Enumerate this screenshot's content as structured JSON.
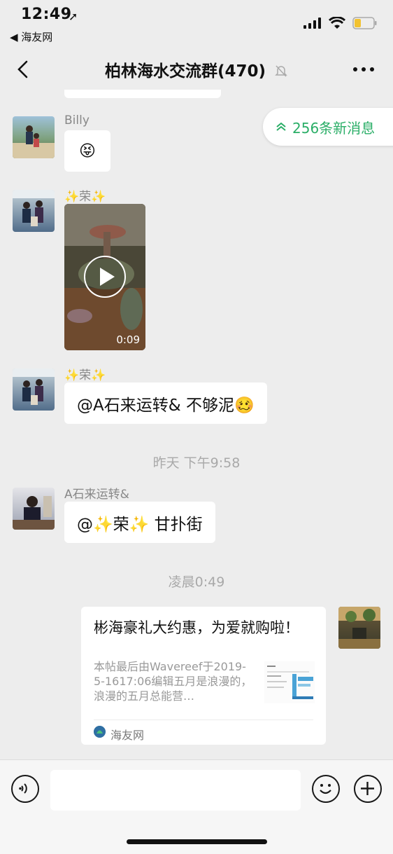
{
  "status": {
    "time": "12:49",
    "back_app": "◀ 海友网"
  },
  "nav": {
    "title": "柏林海水交流群(470)"
  },
  "new_messages": {
    "label": "256条新消息"
  },
  "messages": [
    {
      "sender": "Billy",
      "text": "😝"
    },
    {
      "sender": "✨荣✨",
      "video_duration": "0:09"
    },
    {
      "sender": "✨荣✨",
      "text": "@A石来运转& 不够泥🥴"
    },
    {
      "time": "昨天 下午9:58"
    },
    {
      "sender": "A石来运转&",
      "text": "@✨荣✨ 甘扑街"
    },
    {
      "time": "凌晨0:49"
    },
    {
      "card": {
        "title": "彬海豪礼大约惠，为爱就购啦！",
        "desc": "本帖最后由Wavereef于2019-5-1617:06编辑五月是浪漫的，浪漫的五月总能营…",
        "source": "海友网"
      }
    }
  ],
  "colors": {
    "background": "#ededed",
    "accent_green": "#2aae67",
    "bubble": "#ffffff"
  }
}
